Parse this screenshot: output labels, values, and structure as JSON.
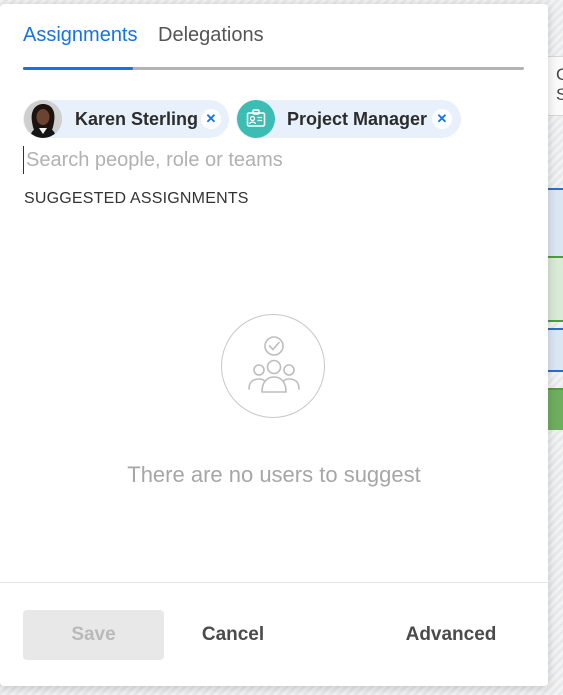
{
  "tabs": [
    {
      "label": "Assignments",
      "active": true
    },
    {
      "label": "Delegations",
      "active": false
    }
  ],
  "chips": [
    {
      "label": "Karen Sterling",
      "type": "person",
      "icon": "user-avatar"
    },
    {
      "label": "Project Manager",
      "type": "role",
      "icon": "job-role-icon",
      "icon_color": "#3bbdb3"
    }
  ],
  "search": {
    "placeholder": "Search people, role or teams",
    "value": ""
  },
  "suggested": {
    "title": "SUGGESTED ASSIGNMENTS",
    "empty_message": "There are no users to suggest",
    "empty_icon": "people-group-check-icon"
  },
  "footer": {
    "save_label": "Save",
    "cancel_label": "Cancel",
    "advanced_label": "Advanced"
  },
  "background": {
    "header_glyphs": [
      "C",
      "S"
    ]
  },
  "colors": {
    "accent": "#1473e6",
    "chip_bg": "#e8f1fb",
    "role_icon": "#3bbdb3",
    "disabled_text": "#b9b9b9"
  }
}
